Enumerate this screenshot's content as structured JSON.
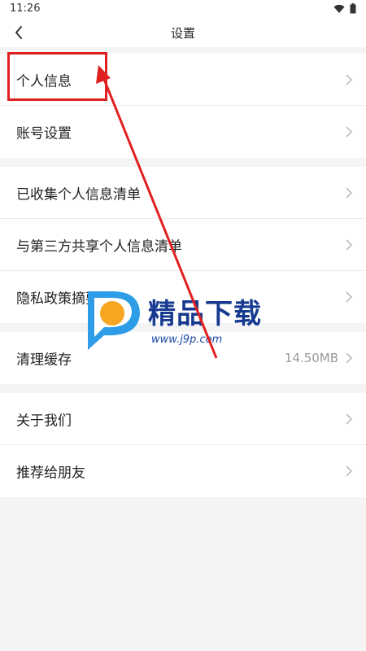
{
  "status_bar": {
    "time": "11:26"
  },
  "header": {
    "title": "设置"
  },
  "groups": [
    {
      "items": [
        {
          "label": "个人信息"
        },
        {
          "label": "账号设置"
        }
      ]
    },
    {
      "items": [
        {
          "label": "已收集个人信息清单"
        },
        {
          "label": "与第三方共享个人信息清单"
        },
        {
          "label": "隐私政策摘要"
        }
      ]
    },
    {
      "items": [
        {
          "label": "清理缓存",
          "value": "14.50MB"
        }
      ]
    },
    {
      "items": [
        {
          "label": "关于我们"
        },
        {
          "label": "推荐给朋友"
        }
      ]
    }
  ],
  "watermark": {
    "text": "精品下载",
    "url": "www.j9p.com"
  },
  "colors": {
    "highlight": "#e02020",
    "background": "#f4f4f4",
    "watermark": "#163a8f"
  },
  "icons": [
    "wifi-icon",
    "battery-icon",
    "back-arrow-icon",
    "chevron-right-icon",
    "logo-icon"
  ]
}
